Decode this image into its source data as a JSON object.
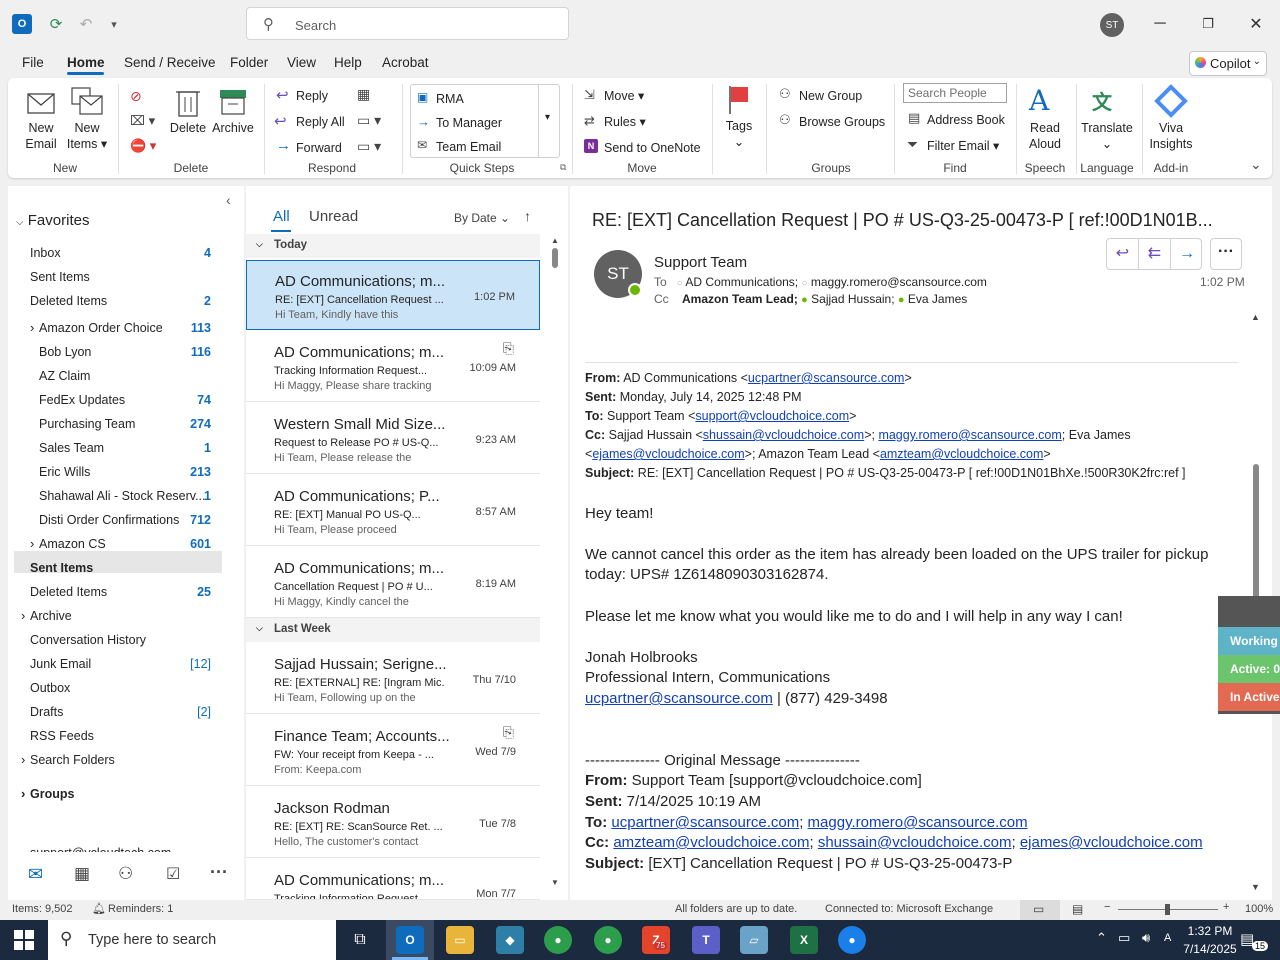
{
  "titlebar": {
    "search_placeholder": "Search",
    "avatar": "ST"
  },
  "menu": [
    "File",
    "Home",
    "Send / Receive",
    "Folder",
    "View",
    "Help",
    "Acrobat"
  ],
  "copilot": "Copilot",
  "ribbon": {
    "new_email": [
      "New",
      "Email"
    ],
    "new_items": [
      "New",
      "Items"
    ],
    "delete": "Delete",
    "archive": "Archive",
    "reply": "Reply",
    "reply_all": "Reply All",
    "forward": "Forward",
    "quick_steps": [
      "RMA",
      "To Manager",
      "Team Email"
    ],
    "move": "Move",
    "rules": "Rules",
    "onenote": "Send to OneNote",
    "tags": "Tags",
    "new_group": "New Group",
    "browse_groups": "Browse Groups",
    "search_people": "Search People",
    "address_book": "Address Book",
    "filter_email": "Filter Email",
    "read_aloud": [
      "Read",
      "Aloud"
    ],
    "translate": "Translate",
    "viva": [
      "Viva",
      "Insights"
    ],
    "groups": {
      "new": "New",
      "delete": "Delete",
      "respond": "Respond",
      "quick_steps": "Quick Steps",
      "move": "Move",
      "groups": "Groups",
      "find": "Find",
      "speech": "Speech",
      "language": "Language",
      "addin": "Add-in"
    }
  },
  "nav": {
    "favorites": "Favorites",
    "items": [
      {
        "label": "Inbox",
        "count": "4"
      },
      {
        "label": "Sent Items",
        "count": ""
      },
      {
        "label": "Deleted Items",
        "count": "2"
      },
      {
        "label": "Amazon Order Choice",
        "count": "113"
      },
      {
        "label": "Bob Lyon",
        "count": "116"
      },
      {
        "label": "AZ Claim",
        "count": ""
      },
      {
        "label": "FedEx Updates",
        "count": "74"
      },
      {
        "label": "Purchasing Team",
        "count": "274"
      },
      {
        "label": "Sales Team",
        "count": "1"
      },
      {
        "label": "Eric Wills",
        "count": "213"
      },
      {
        "label": "Shahawal Ali - Stock Reserv...",
        "count": "1"
      },
      {
        "label": "Disti Order Confirmations",
        "count": "712"
      },
      {
        "label": "Amazon CS",
        "count": "601"
      },
      {
        "label": "Sent Items",
        "count": ""
      },
      {
        "label": "Deleted Items",
        "count": "25"
      },
      {
        "label": "Archive",
        "count": ""
      },
      {
        "label": "Conversation History",
        "count": ""
      },
      {
        "label": "Junk Email",
        "count": "[12]"
      },
      {
        "label": "Outbox",
        "count": ""
      },
      {
        "label": "Drafts",
        "count": "[2]"
      },
      {
        "label": "RSS Feeds",
        "count": ""
      },
      {
        "label": "Search Folders",
        "count": ""
      },
      {
        "label": "Groups",
        "count": ""
      },
      {
        "label": "support@vcloudtech.com",
        "count": ""
      }
    ]
  },
  "list": {
    "tab_all": "All",
    "tab_unread": "Unread",
    "sort": "By Date",
    "sec_today": "Today",
    "sec_lastweek": "Last Week",
    "messages": [
      {
        "from": "AD Communications; m...",
        "subject": "RE: [EXT] Cancellation Request ...",
        "preview": "Hi Team,  Kindly have this",
        "time": "1:02 PM"
      },
      {
        "from": "AD Communications; m...",
        "subject": "Tracking Information Request...",
        "preview": "Hi Maggy,  Please share tracking",
        "time": "10:09 AM"
      },
      {
        "from": "Western Small Mid Size...",
        "subject": "Request to Release PO # US-Q...",
        "preview": "Hi Team,  Please release the",
        "time": "9:23 AM"
      },
      {
        "from": "AD Communications; P...",
        "subject": "RE: [EXT] Manual PO      US-Q...",
        "preview": "Hi Team,  Please proceed",
        "time": "8:57 AM"
      },
      {
        "from": "AD Communications; m...",
        "subject": "Cancellation Request | PO # U...",
        "preview": "Hi Maggy,  Kindly cancel the",
        "time": "8:19 AM"
      },
      {
        "from": "Sajjad Hussain; Serigne...",
        "subject": "RE: [EXTERNAL] RE: [Ingram Mic...",
        "preview": "Hi Team,  Following up on the",
        "time": "Thu 7/10"
      },
      {
        "from": "Finance Team; Accounts...",
        "subject": "FW: Your receipt from Keepa - ...",
        "preview": "From: Keepa.com",
        "time": "Wed 7/9"
      },
      {
        "from": "Jackson Rodman",
        "subject": "RE: [EXT] RE: ScanSource Ret. ...",
        "preview": "Hello,  The customer's contact",
        "time": "Tue 7/8"
      },
      {
        "from": "AD Communications; m...",
        "subject": "Tracking Information Request",
        "preview": "",
        "time": "Mon 7/7"
      }
    ]
  },
  "reading": {
    "subject": "RE: [EXT] Cancellation Request | PO # US-Q3-25-00473-P    [ ref:!00D1N01B...",
    "sender": "Support Team",
    "avatar": "ST",
    "to_label": "To",
    "to": "AD Communications;",
    "to2": "maggy.romero@scansource.com",
    "cc_label": "Cc",
    "cc1": "Amazon Team Lead;",
    "cc2": "Sajjad Hussain;",
    "cc3": "Eva James",
    "time": "1:02 PM",
    "hdr_from_label": "From:",
    "hdr_from": "AD Communications <",
    "hdr_from_email": "ucpartner@scansource.com",
    "hdr_sent_label": "Sent:",
    "hdr_sent": "Monday, July 14, 2025 12:48 PM",
    "hdr_to_label": "To:",
    "hdr_to": "Support Team <",
    "hdr_to_email": "support@vcloudchoice.com",
    "hdr_cc_label": "Cc:",
    "hdr_cc1": "Sajjad Hussain <",
    "hdr_cc1_email": "shussain@vcloudchoice.com",
    "hdr_cc2_email": "maggy.romero@scansource.com",
    "hdr_cc3": "; Eva James",
    "hdr_cc4_email": "ejames@vcloudchoice.com",
    "hdr_cc5": ">; Amazon Team Lead <",
    "hdr_cc5_email": "amzteam@vcloudchoice.com",
    "hdr_subject_label": "Subject:",
    "hdr_subject": "RE: [EXT] Cancellation Request | PO # US-Q3-25-00473-P [ ref:!00D1N01BhXe.!500R30K2frc:ref ]",
    "greeting": "Hey team!",
    "para1a": "We cannot cancel this order as the item has already been loaded on the UPS trailer for pickup",
    "para1b": "today:  UPS# 1Z6148090303162874.",
    "para2": "Please let me know what you would like me to do and I will help in any way I can!",
    "sig_name": "Jonah Holbrooks",
    "sig_title": "Professional Intern, Communications",
    "sig_email": "ucpartner@scansource.com",
    "sig_phone": " | (877) 429-3498",
    "orig_marker": "--------------- Original Message ---------------",
    "orig_from_label": "From:",
    "orig_from": "Support Team [support@vcloudchoice.com]",
    "orig_sent_label": "Sent:",
    "orig_sent": "7/14/2025 10:19 AM",
    "orig_to_label": "To:",
    "orig_to1": "ucpartner@scansource.com",
    "orig_to2": "maggy.romero@scansource.com",
    "orig_cc_label": "Cc:",
    "orig_cc1": "amzteam@vcloudchoice.com",
    "orig_cc2": "shussain@vcloudchoice.com",
    "orig_cc3": "ejames@vcloudchoice.com",
    "orig_subject_label": "Subject:",
    "orig_subject": "[EXT] Cancellation Request | PO # US-Q3-25-00473-P"
  },
  "overlay": {
    "working": "Working",
    "active": "Active: 0",
    "inactive": "In Active"
  },
  "status": {
    "items": "Items: 9,502",
    "reminders": "Reminders: 1",
    "sync": "All folders are up to date.",
    "connected": "Connected to: Microsoft Exchange",
    "zoom": "100%"
  },
  "taskbar": {
    "search": "Type here to search",
    "time": "1:32 PM",
    "date": "7/14/2025",
    "notif": "15",
    "zoom_badge": "75"
  },
  "colors": {
    "accent": "#0f6cbd",
    "selected": "#cce4f7",
    "taskbar": "#1c2a3f"
  }
}
